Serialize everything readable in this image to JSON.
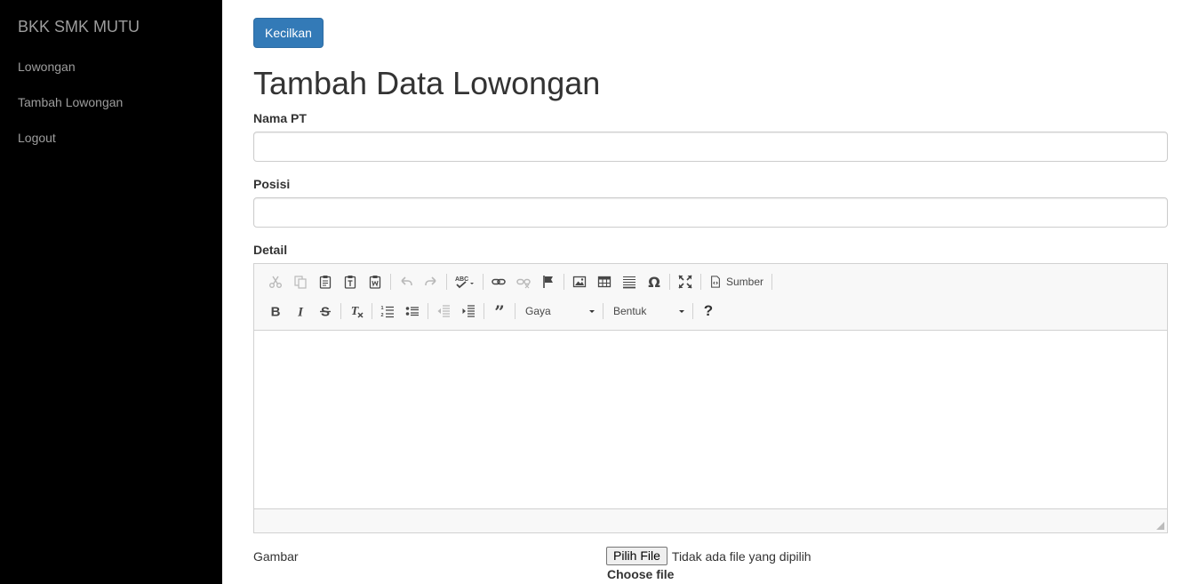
{
  "sidebar": {
    "brand": "BKK SMK MUTU",
    "items": [
      {
        "label": "Lowongan"
      },
      {
        "label": "Tambah Lowongan"
      },
      {
        "label": "Logout"
      }
    ]
  },
  "main": {
    "collapse_button": "Kecilkan",
    "title": "Tambah Data Lowongan",
    "fields": {
      "nama_pt": {
        "label": "Nama PT",
        "value": ""
      },
      "posisi": {
        "label": "Posisi",
        "value": ""
      },
      "detail": {
        "label": "Detail"
      }
    },
    "editor": {
      "source_label": "Sumber",
      "style_combo": "Gaya",
      "format_combo": "Bentuk",
      "help": "?",
      "content": ""
    },
    "gambar": {
      "label": "Gambar",
      "file_button": "Pilih File",
      "file_status": "Tidak ada file yang dipilih",
      "choose_file": "Choose file"
    }
  },
  "colors": {
    "sidebar_bg": "#000000",
    "sidebar_text": "#9d9d9d",
    "primary": "#337ab7"
  }
}
